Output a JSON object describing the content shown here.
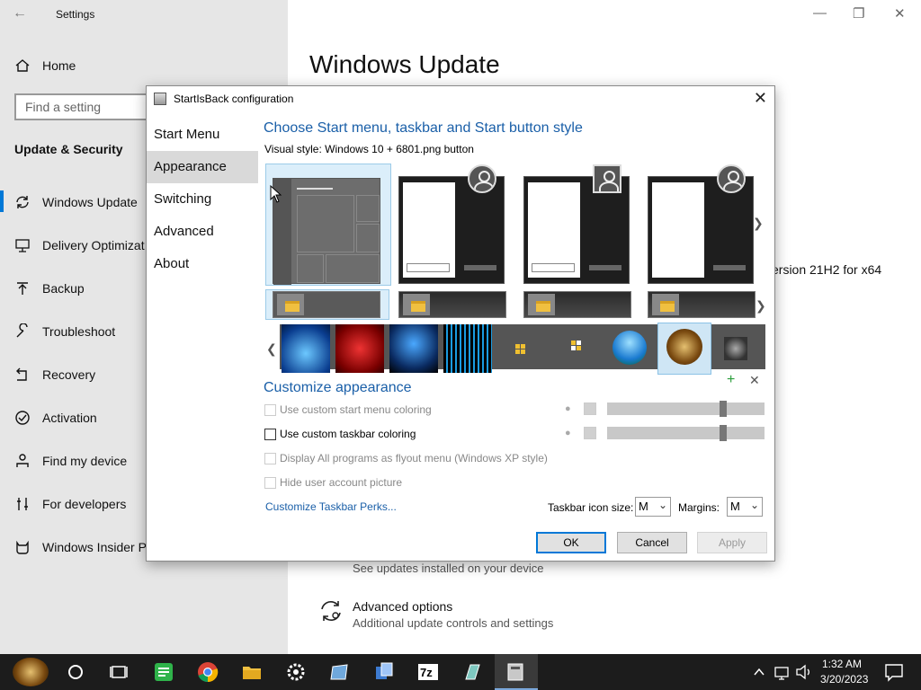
{
  "settings": {
    "window_title": "Settings",
    "home_label": "Home",
    "search_placeholder": "Find a setting",
    "section_title": "Update & Security",
    "nav": [
      {
        "label": "Windows Update"
      },
      {
        "label": "Delivery Optimizat"
      },
      {
        "label": "Backup"
      },
      {
        "label": "Troubleshoot"
      },
      {
        "label": "Recovery"
      },
      {
        "label": "Activation"
      },
      {
        "label": "Find my device"
      },
      {
        "label": "For developers"
      },
      {
        "label": "Windows Insider P"
      }
    ],
    "page_title": "Windows Update",
    "version_text": "ersion 21H2 for x64",
    "update_history_sub": "See updates installed on your device",
    "advanced_title": "Advanced options",
    "advanced_sub": "Additional update controls and settings"
  },
  "dialog": {
    "title": "StartIsBack configuration",
    "nav": [
      "Start Menu",
      "Appearance",
      "Switching",
      "Advanced",
      "About"
    ],
    "selected_nav": "Appearance",
    "style_heading": "Choose Start menu, taskbar and Start button style",
    "visual_style_label": "Visual style:",
    "visual_style_value": "Windows 10 + 6801.png button",
    "customize_heading": "Customize appearance",
    "options": [
      {
        "label": "Use custom start menu coloring",
        "checked": false,
        "enabled": false
      },
      {
        "label": "Use custom taskbar coloring",
        "checked": false,
        "enabled": true
      },
      {
        "label": "Display All programs as flyout menu (Windows XP style)",
        "checked": false,
        "enabled": false
      },
      {
        "label": "Hide user account picture",
        "checked": false,
        "enabled": false
      }
    ],
    "start_menu_opacity": 0.75,
    "taskbar_opacity": 0.75,
    "perks_link": "Customize Taskbar Perks...",
    "icon_size_label": "Taskbar icon size:",
    "icon_size_value": "M",
    "margins_label": "Margins:",
    "margins_value": "M",
    "buttons": {
      "ok": "OK",
      "cancel": "Cancel",
      "apply": "Apply"
    }
  },
  "tray": {
    "time": "1:32 AM",
    "date": "3/20/2023"
  },
  "colors": {
    "accent": "#0078d7",
    "link": "#1a5fa8",
    "taskbar": "#1c1c1c"
  }
}
